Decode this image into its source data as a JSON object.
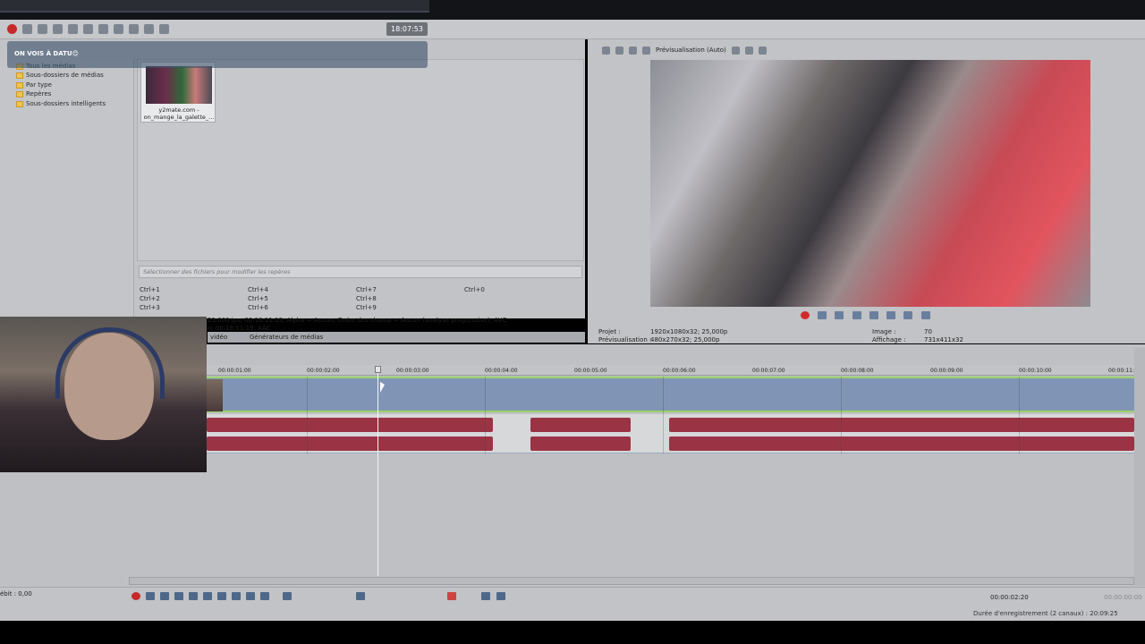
{
  "header": {
    "clock": "18:07:53"
  },
  "overlay": {
    "text": "ON VOIS À DATU😊"
  },
  "explorer": {
    "tree": [
      {
        "label": "Tous les médias"
      },
      {
        "label": "Sous-dossiers de médias"
      },
      {
        "label": "Par type"
      },
      {
        "label": "Repères"
      },
      {
        "label": "Sous-dossiers intelligents"
      }
    ],
    "media": {
      "name_line1": "y2mate.com -",
      "name_line2": "on_mange_la_galette_..."
    },
    "search_placeholder": "Sélectionner des fichiers pour modifier les repères",
    "shortcuts": [
      "Ctrl+1",
      "Ctrl+4",
      "Ctrl+7",
      "Ctrl+0",
      "Ctrl+2",
      "Ctrl+5",
      "Ctrl+8",
      "Ctrl+3",
      "Ctrl+6",
      "Ctrl+9"
    ],
    "info_line1": "25,000 ips; 00:18:11:19; Alpha = Aucun; Ordre des champ = Aucun (analyse progressive); AVC",
    "info_line2": "o; 00:18:11:19; AAC",
    "tabs": [
      "vidéo",
      "Générateurs de médias"
    ]
  },
  "preview": {
    "mode": "Prévisualisation (Auto)",
    "projet_label": "Projet :",
    "projet_value": "1920x1080x32; 25,000p",
    "prev_label": "Prévisualisation :",
    "prev_value": "480x270x32; 25,000p",
    "image_label": "Image :",
    "image_value": "70",
    "affichage_label": "Affichage :",
    "affichage_value": "731x411x32"
  },
  "timeline": {
    "ticks": [
      "00:00:01:00",
      "00:00:02:00",
      "00:00:03:00",
      "00:00:04:00",
      "00:00:05:00",
      "00:00:06:00",
      "00:00:07:00",
      "00:00:08:00",
      "00:00:09:00",
      "00:00:10:00",
      "00:00:11:"
    ]
  },
  "transport": {
    "debit": "ébit : 0,00",
    "time": "00:00:02:20",
    "time2": "00:00:00:00"
  },
  "status": {
    "duration": "Durée d'enregistrement (2 canaux) : 20:09:25"
  }
}
